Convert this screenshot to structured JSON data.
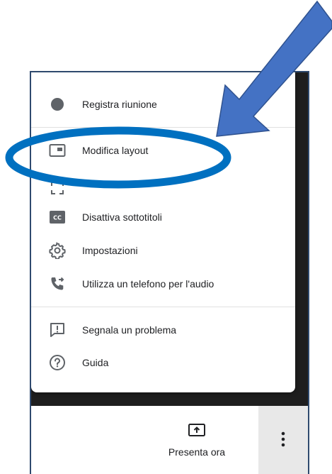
{
  "menu": {
    "items": [
      {
        "label": "Registra riunione",
        "icon": "record-dot-icon"
      },
      {
        "label": "Modifica layout",
        "icon": "layout-icon"
      },
      {
        "label": "",
        "icon": "fullscreen-icon"
      },
      {
        "label": "Disattiva sottotitoli",
        "icon": "closed-captions-icon"
      },
      {
        "label": "Impostazioni",
        "icon": "gear-icon"
      },
      {
        "label": "Utilizza un telefono per l'audio",
        "icon": "phone-forward-icon"
      },
      {
        "label": "Segnala un problema",
        "icon": "report-problem-icon"
      },
      {
        "label": "Guida",
        "icon": "help-icon"
      }
    ]
  },
  "cc_icon_text": "CC",
  "bottom_bar": {
    "present_label": "Presenta ora",
    "present_icon": "present-screen-icon",
    "more_icon": "more-vertical-icon"
  },
  "annotation": {
    "arrow_color": "#4472c4",
    "ellipse_color": "#0070c0"
  }
}
